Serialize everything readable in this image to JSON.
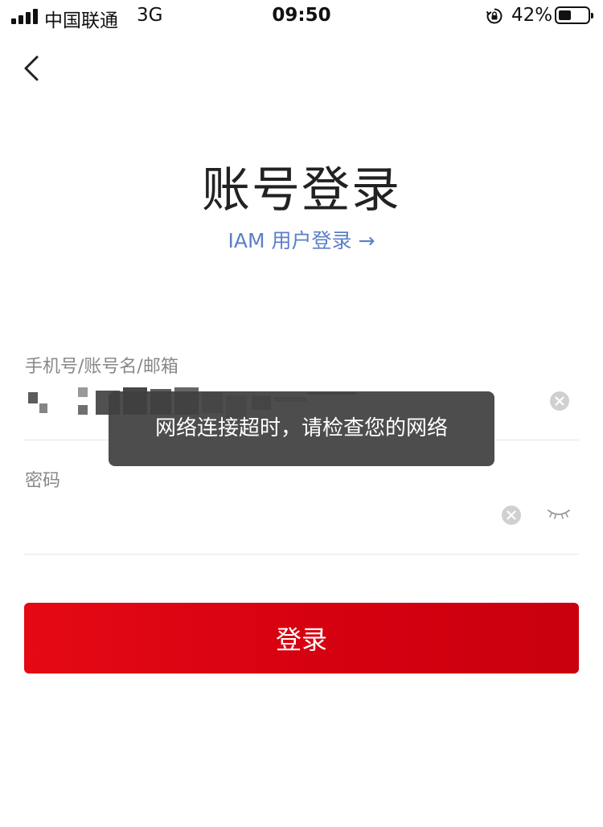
{
  "status_bar": {
    "carrier": "中国联通",
    "network": "3G",
    "time": "09:50",
    "battery_percent": "42%",
    "battery_level": 0.42
  },
  "header": {
    "back_icon": "chevron-left-icon"
  },
  "title": "账号登录",
  "iam_link": "IAM 用户登录 →",
  "account_field": {
    "label": "手机号/账号名/邮箱",
    "value_redacted": true,
    "clear_icon": "clear-circle-icon"
  },
  "password_field": {
    "label": "密码",
    "value": "",
    "clear_icon": "clear-circle-icon",
    "visibility_icon": "eye-closed-icon"
  },
  "login_button": {
    "label": "登录",
    "color": "#e50914"
  },
  "toast": {
    "message": "网络连接超时，请检查您的网络"
  },
  "colors": {
    "link": "#5b7fc8",
    "primary": "#d40010",
    "label": "#888888"
  }
}
